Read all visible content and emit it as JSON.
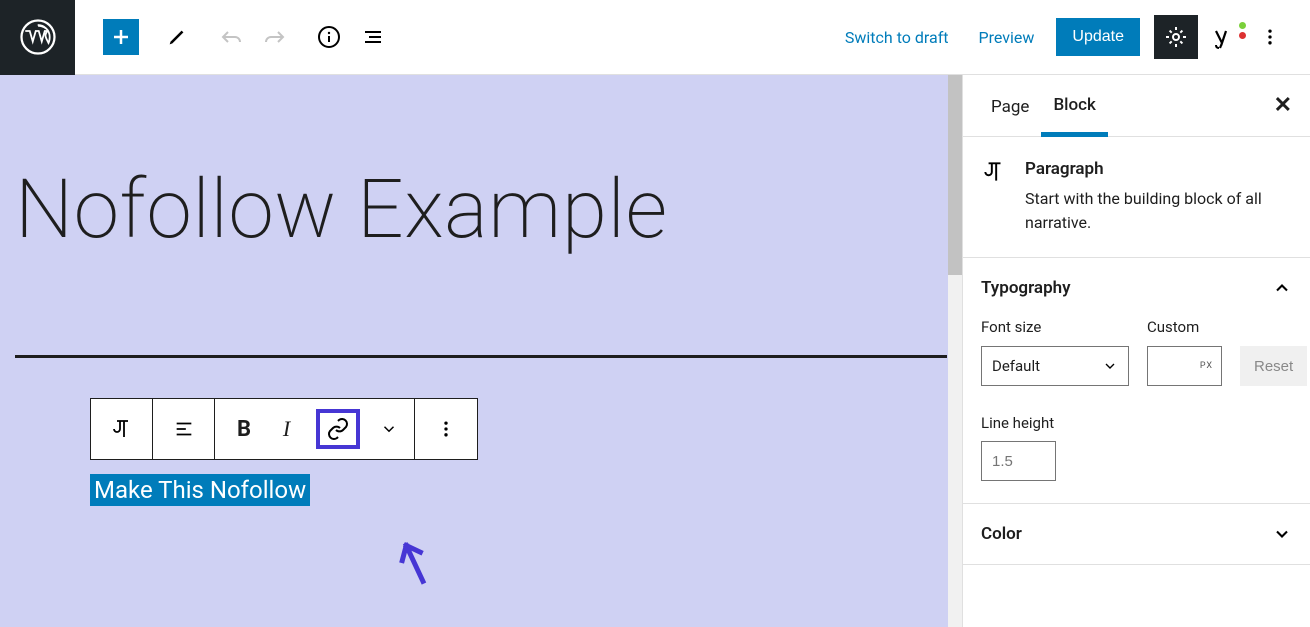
{
  "header": {
    "switch_to_draft": "Switch to draft",
    "preview": "Preview",
    "update": "Update"
  },
  "canvas": {
    "title": "Nofollow Example",
    "selected_text": "Make This Nofollow"
  },
  "sidebar": {
    "tabs": {
      "page": "Page",
      "block": "Block"
    },
    "block_info": {
      "name": "Paragraph",
      "desc": "Start with the building block of all narrative."
    },
    "typography": {
      "title": "Typography",
      "font_size_label": "Font size",
      "font_size_value": "Default",
      "custom_label": "Custom",
      "px_unit": "PX",
      "reset": "Reset",
      "line_height_label": "Line height",
      "line_height_placeholder": "1.5"
    },
    "color": {
      "title": "Color"
    }
  }
}
